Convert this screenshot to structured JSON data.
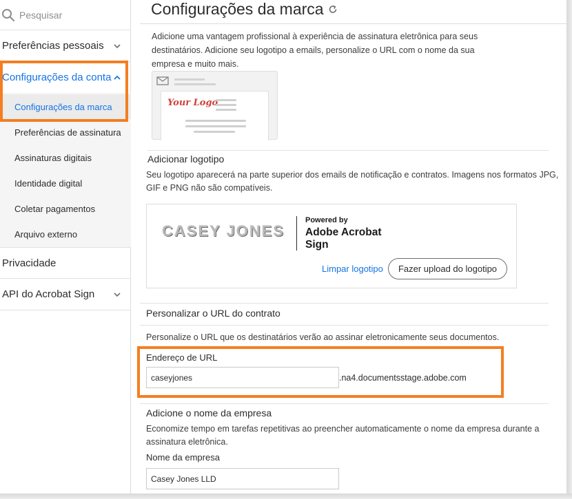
{
  "sidebar": {
    "search_placeholder": "Pesquisar",
    "items": [
      {
        "label": "Preferências pessoais"
      },
      {
        "label": "Configurações da conta"
      },
      {
        "label": "Privacidade"
      },
      {
        "label": "API do Acrobat Sign"
      }
    ],
    "sub_items": [
      {
        "label": "Configurações da marca"
      },
      {
        "label": "Preferências de assinatura"
      },
      {
        "label": "Assinaturas digitais"
      },
      {
        "label": "Identidade digital"
      },
      {
        "label": "Coletar pagamentos"
      },
      {
        "label": "Arquivo externo"
      }
    ]
  },
  "main": {
    "title": "Configurações da marca",
    "intro": "Adicione uma vantagem profissional à experiência de assinatura eletrônica para seus destinatários. Adicione seu logotipo a emails, personalize o URL com o nome da sua empresa e muito mais.",
    "preview_logo_text": "Your Logo",
    "logo_section": {
      "heading": "Adicionar logotipo",
      "description": "Seu logotipo aparecerá na parte superior dos emails de notificação e contratos. Imagens nos formatos JPG, GIF e PNG não são compatíveis.",
      "logo_text": "CASEY JONES",
      "powered_by": "Powered by",
      "powered_brand": "Adobe Acrobat Sign",
      "clear_link": "Limpar logotipo",
      "upload_button": "Fazer upload do logotipo"
    },
    "url_section": {
      "heading": "Personalizar o URL do contrato",
      "description": "Personalize o URL que os destinatários verão ao assinar eletronicamente seus documentos.",
      "field_label": "Endereço de URL",
      "field_value": "caseyjones",
      "suffix": ".na4.documentsstage.adobe.com"
    },
    "company_section": {
      "heading": "Adicione o nome da empresa",
      "description": "Economize tempo em tarefas repetitivas ao preencher automaticamente o nome da empresa durante a assinatura eletrônica.",
      "field_label": "Nome da empresa",
      "field_value": "Casey Jones LLD"
    }
  },
  "colors": {
    "accent": "#1473e6",
    "highlight": "#f47e20",
    "logo_red": "#d3403a"
  }
}
